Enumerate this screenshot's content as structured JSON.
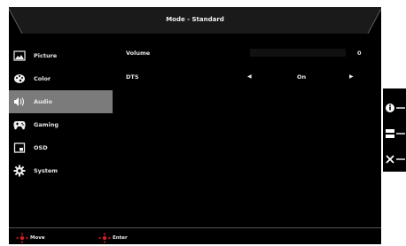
{
  "header": {
    "title": "Mode - Standard"
  },
  "sidebar": {
    "items": [
      {
        "label": "Picture",
        "icon": "picture-icon"
      },
      {
        "label": "Color",
        "icon": "color-palette-icon"
      },
      {
        "label": "Audio",
        "icon": "speaker-icon",
        "active": true
      },
      {
        "label": "Gaming",
        "icon": "gamepad-icon"
      },
      {
        "label": "OSD",
        "icon": "osd-window-icon"
      },
      {
        "label": "System",
        "icon": "gear-icon"
      }
    ]
  },
  "settings": {
    "volume": {
      "label": "Volume",
      "value": "0"
    },
    "dts": {
      "label": "DTS",
      "value": "On"
    }
  },
  "footer": {
    "move_label": "Move",
    "enter_label": "Enter"
  },
  "side_panel": {
    "buttons": [
      {
        "icon": "info-icon"
      },
      {
        "icon": "menu-icon"
      },
      {
        "icon": "close-icon"
      }
    ]
  },
  "colors": {
    "active_item": "#7b7b7b",
    "background": "#000000",
    "nav_icon": "#d22020"
  }
}
